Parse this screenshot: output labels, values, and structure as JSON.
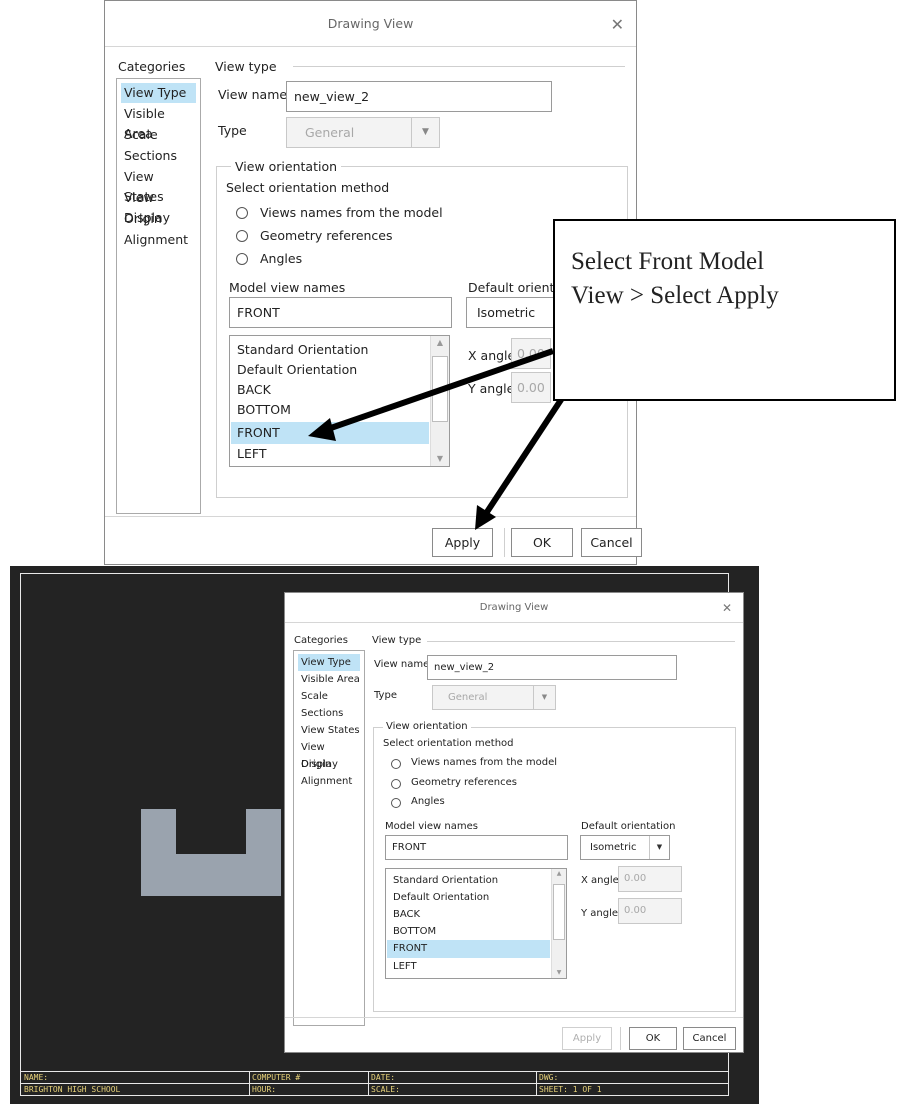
{
  "dialog": {
    "title": "Drawing View",
    "categories_label": "Categories",
    "categories": [
      "View Type",
      "Visible Area",
      "Scale",
      "Sections",
      "View States",
      "View Display",
      "Origin",
      "Alignment"
    ],
    "selected_category": "View Type",
    "view_type_group": "View type",
    "view_name_label": "View name",
    "view_name_value": "new_view_2",
    "type_label": "Type",
    "type_value": "General",
    "orientation_group": "View orientation",
    "orientation_method_label": "Select orientation method",
    "orientation_methods": [
      "Views names from the model",
      "Geometry references",
      "Angles"
    ],
    "selected_method": "Views names from the model",
    "model_view_names_label": "Model view names",
    "model_view_value": "FRONT",
    "model_views": [
      "Standard Orientation",
      "Default Orientation",
      "BACK",
      "BOTTOM",
      "FRONT",
      "LEFT"
    ],
    "selected_view": "FRONT",
    "default_orientation_label": "Default orientation",
    "default_orientation_label_top_visible": "Default orientati",
    "default_orientation_value": "Isometric",
    "x_angle_label": "X angle",
    "x_angle_value": "0.00",
    "y_angle_label": "Y angle",
    "y_angle_value": "0.00",
    "top_x_angle_visible": "0.00",
    "apply_label": "Apply",
    "ok_label": "OK",
    "cancel_label": "Cancel"
  },
  "callout": {
    "line1": "Select Front Model",
    "line2": "View > Select Apply"
  },
  "title_block": {
    "row1": [
      "NAME:",
      "COMPUTER #",
      "DATE:",
      "DWG:"
    ],
    "row2": [
      "BRIGHTON HIGH SCHOOL",
      "HOUR:",
      "SCALE:",
      "SHEET: 1 OF 1"
    ]
  },
  "colors": {
    "selection": "#bfe3f6",
    "cad_background": "#232323",
    "part_fill": "#9aa3ae",
    "title_block_text": "#e7d27a"
  }
}
